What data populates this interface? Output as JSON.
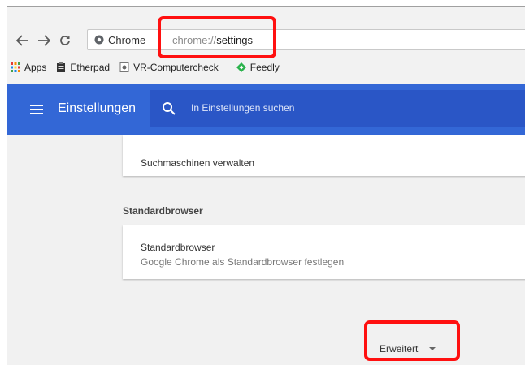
{
  "browser": {
    "site_chip_label": "Chrome",
    "url_scheme": "chrome://",
    "url_path": "settings"
  },
  "bookmarks": [
    {
      "label": "Apps",
      "icon": "apps-grid-icon"
    },
    {
      "label": "Etherpad",
      "icon": "etherpad-icon"
    },
    {
      "label": "VR-Computercheck",
      "icon": "page-icon"
    },
    {
      "label": "Feedly",
      "icon": "feedly-icon"
    }
  ],
  "settings_header": {
    "title": "Einstellungen",
    "search_placeholder": "In Einstellungen suchen"
  },
  "search_engines": {
    "label": "Suchmaschinen verwalten"
  },
  "default_browser_section": {
    "heading": "Standardbrowser",
    "card_title": "Standardbrowser",
    "card_subtitle": "Google Chrome als Standardbrowser festlegen"
  },
  "advanced": {
    "label": "Erweitert"
  },
  "colors": {
    "header_blue": "#3367d6",
    "highlight_red": "#ff1010"
  }
}
